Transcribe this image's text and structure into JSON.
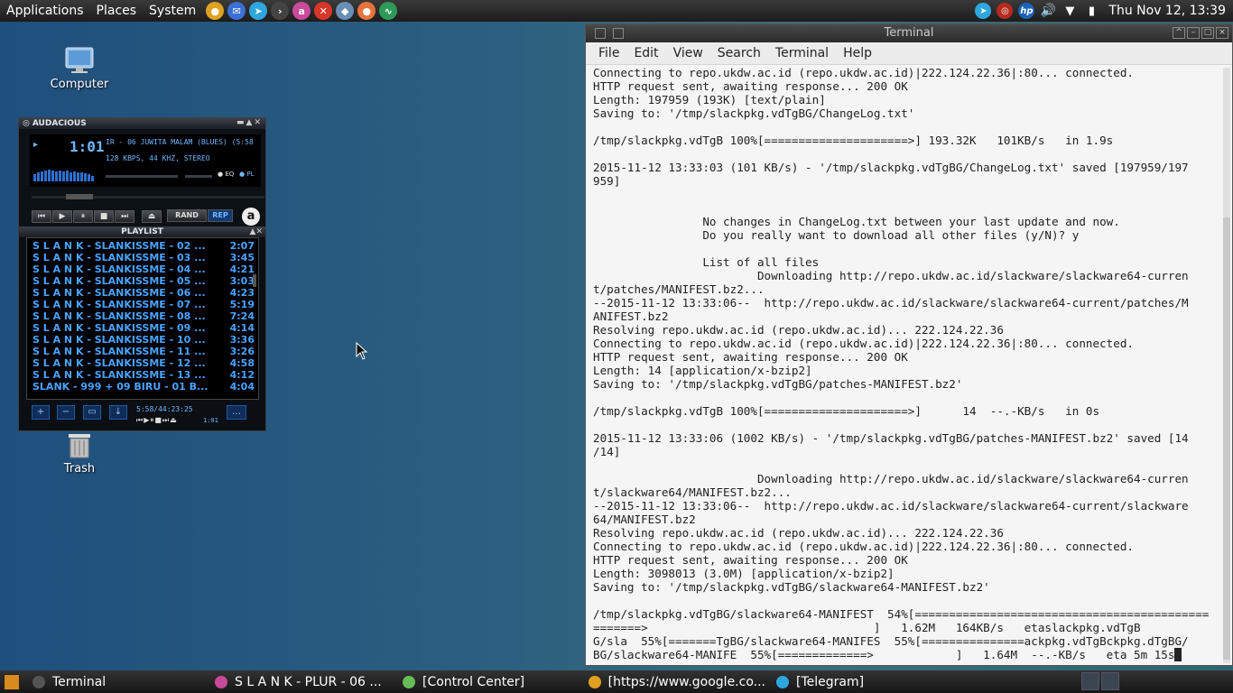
{
  "top_panel": {
    "menus": [
      "Applications",
      "Places",
      "System"
    ],
    "launchers": [
      {
        "name": "chrome-icon",
        "color": "#e0a020"
      },
      {
        "name": "thunderbird-icon",
        "color": "#3b6fd6"
      },
      {
        "name": "telegram-icon",
        "color": "#2ea6de"
      },
      {
        "name": "terminal-icon",
        "color": "#444"
      },
      {
        "name": "audacious-icon",
        "color": "#c84a9a"
      },
      {
        "name": "close-app-icon",
        "color": "#d9362b"
      },
      {
        "name": "network-icon",
        "color": "#6a8fb5"
      },
      {
        "name": "firefox-icon",
        "color": "#e8733a"
      },
      {
        "name": "monitor-icon",
        "color": "#2d9b57"
      }
    ],
    "clock": "Thu Nov 12, 13:39"
  },
  "desktop": {
    "computer_label": "Computer",
    "trash_label": "Trash"
  },
  "audacious": {
    "title": "AUDACIOUS",
    "time": "1:01",
    "song": "IR - 06 JUWITA MALAM (BLUES) (5:58",
    "info": "128 KBPS, 44 KHZ, STEREO",
    "eq_label": "EQ",
    "pl_label": "PL",
    "rand_label": "RAND",
    "rep_label": "REP",
    "logo": "a",
    "playlist_title": "PLAYLIST",
    "playlist": [
      {
        "title": "S L A N K - SLANKISSME - 02 ...",
        "dur": "2:07"
      },
      {
        "title": "S L A N K - SLANKISSME - 03 ...",
        "dur": "3:45"
      },
      {
        "title": "S L A N K - SLANKISSME - 04 ...",
        "dur": "4:21"
      },
      {
        "title": "S L A N K - SLANKISSME - 05 ...",
        "dur": "3:03"
      },
      {
        "title": "S L A N K - SLANKISSME - 06 ...",
        "dur": "4:23"
      },
      {
        "title": "S L A N K - SLANKISSME - 07 ...",
        "dur": "5:19"
      },
      {
        "title": "S L A N K - SLANKISSME - 08 ...",
        "dur": "7:24"
      },
      {
        "title": "S L A N K - SLANKISSME - 09 ...",
        "dur": "4:14"
      },
      {
        "title": "S L A N K - SLANKISSME - 10 ...",
        "dur": "3:36"
      },
      {
        "title": "S L A N K - SLANKISSME - 11 ...",
        "dur": "3:26"
      },
      {
        "title": "S L A N K - SLANKISSME - 12 ...",
        "dur": "4:58"
      },
      {
        "title": "S L A N K - SLANKISSME - 13 ...",
        "dur": "4:12"
      },
      {
        "title": "SLANK - 999 + 09 BIRU - 01 B...",
        "dur": "4:04"
      }
    ],
    "total_time": "5:58/44:23:25",
    "mini_time": "1:01"
  },
  "terminal": {
    "title": "Terminal",
    "menu": [
      "File",
      "Edit",
      "View",
      "Search",
      "Terminal",
      "Help"
    ],
    "lines": [
      "Connecting to repo.ukdw.ac.id (repo.ukdw.ac.id)|222.124.22.36|:80... connected.",
      "HTTP request sent, awaiting response... 200 OK",
      "Length: 197959 (193K) [text/plain]",
      "Saving to: '/tmp/slackpkg.vdTgBG/ChangeLog.txt'",
      "",
      "/tmp/slackpkg.vdTgB 100%[=====================>] 193.32K   101KB/s   in 1.9s",
      "",
      "2015-11-12 13:33:03 (101 KB/s) - '/tmp/slackpkg.vdTgBG/ChangeLog.txt' saved [197959/197",
      "959]",
      "",
      "",
      "                No changes in ChangeLog.txt between your last update and now.",
      "                Do you really want to download all other files (y/N)? y",
      "",
      "                List of all files",
      "                        Downloading http://repo.ukdw.ac.id/slackware/slackware64-curren",
      "t/patches/MANIFEST.bz2...",
      "--2015-11-12 13:33:06--  http://repo.ukdw.ac.id/slackware/slackware64-current/patches/M",
      "ANIFEST.bz2",
      "Resolving repo.ukdw.ac.id (repo.ukdw.ac.id)... 222.124.22.36",
      "Connecting to repo.ukdw.ac.id (repo.ukdw.ac.id)|222.124.22.36|:80... connected.",
      "HTTP request sent, awaiting response... 200 OK",
      "Length: 14 [application/x-bzip2]",
      "Saving to: '/tmp/slackpkg.vdTgBG/patches-MANIFEST.bz2'",
      "",
      "/tmp/slackpkg.vdTgB 100%[=====================>]      14  --.-KB/s   in 0s",
      "",
      "2015-11-12 13:33:06 (1002 KB/s) - '/tmp/slackpkg.vdTgBG/patches-MANIFEST.bz2' saved [14",
      "/14]",
      "",
      "                        Downloading http://repo.ukdw.ac.id/slackware/slackware64-curren",
      "t/slackware64/MANIFEST.bz2...",
      "--2015-11-12 13:33:06--  http://repo.ukdw.ac.id/slackware/slackware64-current/slackware",
      "64/MANIFEST.bz2",
      "Resolving repo.ukdw.ac.id (repo.ukdw.ac.id)... 222.124.22.36",
      "Connecting to repo.ukdw.ac.id (repo.ukdw.ac.id)|222.124.22.36|:80... connected.",
      "HTTP request sent, awaiting response... 200 OK",
      "Length: 3098013 (3.0M) [application/x-bzip2]",
      "Saving to: '/tmp/slackpkg.vdTgBG/slackware64-MANIFEST.bz2'",
      "",
      "/tmp/slackpkg.vdTgBG/slackware64-MANIFEST  54%[===========================================",
      "=======>                                 ]   1.62M   164KB/s   etaslackpkg.vdTgB",
      "G/sla  55%[=======TgBG/slackware64-MANIFES  55%[===============ackpkg.vdTgBckpkg.dTgBG/",
      "BG/slackware64-MANIFE  55%[=============>            ]   1.64M  --.-KB/s   eta 5m 15s"
    ]
  },
  "taskbar": {
    "tasks": [
      {
        "label": "Terminal",
        "icon": "terminal-icon",
        "color": "#555"
      },
      {
        "label": "S L A N K - PLUR - 06 ...",
        "icon": "audacious-icon",
        "color": "#c84a9a"
      },
      {
        "label": "[Control Center]",
        "icon": "control-center-icon",
        "color": "#6b5"
      },
      {
        "label": "[https://www.google.co...",
        "icon": "chrome-icon",
        "color": "#e0a020"
      },
      {
        "label": "[Telegram]",
        "icon": "telegram-icon",
        "color": "#2ea6de"
      }
    ]
  }
}
